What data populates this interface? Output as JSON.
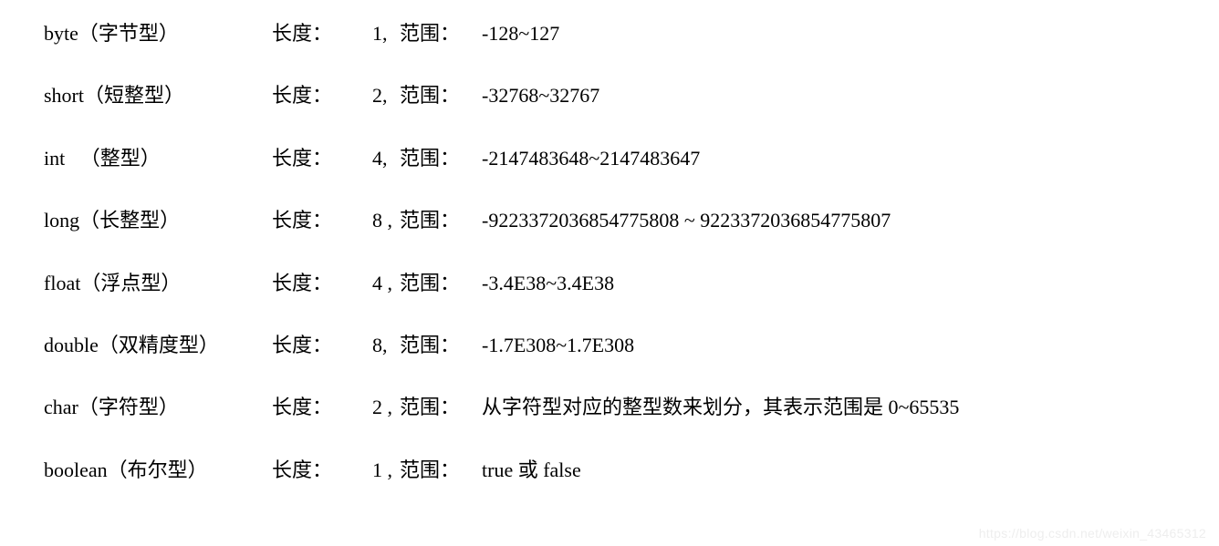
{
  "labels": {
    "length": "长度：",
    "range": "范围："
  },
  "rows": [
    {
      "type_en": "byte",
      "type_cn": "（字节型）",
      "length": "1,",
      "range": "-128~127"
    },
    {
      "type_en": "short",
      "type_cn": "（短整型）",
      "length": "2,",
      "range": "-32768~32767"
    },
    {
      "type_en": "int",
      "type_cn": "（整型）",
      "length": "4,",
      "range": "-2147483648~2147483647"
    },
    {
      "type_en": "long",
      "type_cn": "（长整型）",
      "length": "8 ,",
      "range": "-9223372036854775808 ~ 9223372036854775807"
    },
    {
      "type_en": "float",
      "type_cn": "（浮点型）",
      "length": "4 ,",
      "range": "-3.4E38~3.4E38"
    },
    {
      "type_en": "double",
      "type_cn": "（双精度型）",
      "length": "8,",
      "range": "-1.7E308~1.7E308"
    },
    {
      "type_en": "char",
      "type_cn": "（字符型）",
      "length": "2 ,",
      "range": "从字符型对应的整型数来划分，其表示范围是 0~65535"
    },
    {
      "type_en": "boolean",
      "type_cn": "（布尔型）",
      "length": "1 ,",
      "range": "true 或 false"
    }
  ],
  "watermark": "https://blog.csdn.net/weixin_43465312"
}
